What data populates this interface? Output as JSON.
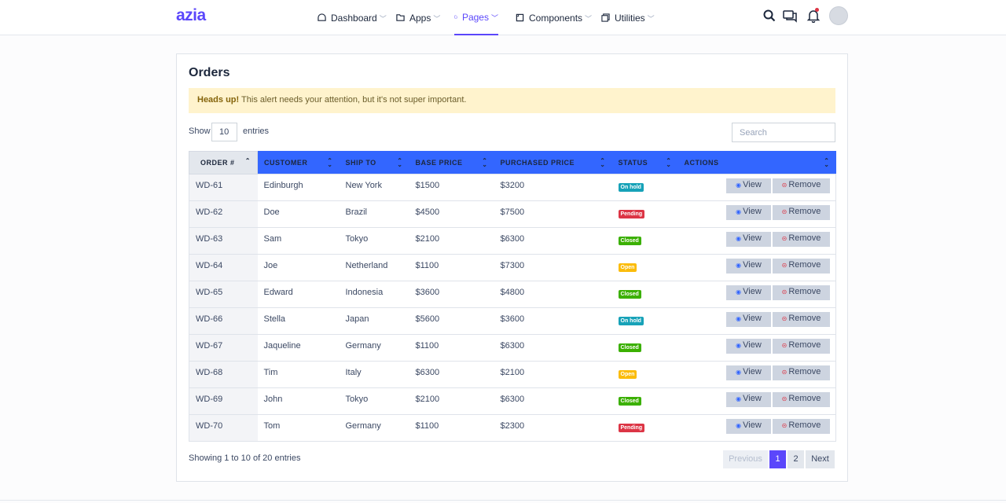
{
  "brand": "azia",
  "nav": [
    {
      "label": "Dashboard",
      "icon": "dashboard-icon"
    },
    {
      "label": "Apps",
      "icon": "folder-icon"
    },
    {
      "label": "Pages",
      "icon": "document-icon"
    },
    {
      "label": "Components",
      "icon": "box-icon"
    },
    {
      "label": "Utilities",
      "icon": "layers-icon"
    }
  ],
  "active_nav": "Pages",
  "colors": {
    "accent": "#5b47fb",
    "table_header": "#3366ff",
    "alert_bg": "#fff3cd"
  },
  "card": {
    "title": "Orders",
    "alert": {
      "strong": "Heads up!",
      "text": "This alert needs your attention, but it's not super important."
    },
    "show_label": "Show",
    "show_value": "10",
    "entries_label": "entries",
    "search_placeholder": "Search"
  },
  "table": {
    "columns": [
      "Order #",
      "Customer",
      "Ship To",
      "Base Price",
      "Purchased Price",
      "Status",
      "Actions"
    ],
    "view_label": "View",
    "remove_label": "Remove",
    "rows": [
      {
        "order": "WD-61",
        "customer": "Edinburgh",
        "ship": "New York",
        "base": "$1500",
        "purchased": "$3200",
        "status": "On hold"
      },
      {
        "order": "WD-62",
        "customer": "Doe",
        "ship": "Brazil",
        "base": "$4500",
        "purchased": "$7500",
        "status": "Pending"
      },
      {
        "order": "WD-63",
        "customer": "Sam",
        "ship": "Tokyo",
        "base": "$2100",
        "purchased": "$6300",
        "status": "Closed"
      },
      {
        "order": "WD-64",
        "customer": "Joe",
        "ship": "Netherland",
        "base": "$1100",
        "purchased": "$7300",
        "status": "Open"
      },
      {
        "order": "WD-65",
        "customer": "Edward",
        "ship": "Indonesia",
        "base": "$3600",
        "purchased": "$4800",
        "status": "Closed"
      },
      {
        "order": "WD-66",
        "customer": "Stella",
        "ship": "Japan",
        "base": "$5600",
        "purchased": "$3600",
        "status": "On hold"
      },
      {
        "order": "WD-67",
        "customer": "Jaqueline",
        "ship": "Germany",
        "base": "$1100",
        "purchased": "$6300",
        "status": "Closed"
      },
      {
        "order": "WD-68",
        "customer": "Tim",
        "ship": "Italy",
        "base": "$6300",
        "purchased": "$2100",
        "status": "Open"
      },
      {
        "order": "WD-69",
        "customer": "John",
        "ship": "Tokyo",
        "base": "$2100",
        "purchased": "$6300",
        "status": "Closed"
      },
      {
        "order": "WD-70",
        "customer": "Tom",
        "ship": "Germany",
        "base": "$1100",
        "purchased": "$2300",
        "status": "Pending"
      }
    ],
    "status_colors": {
      "On hold": "#17a2b8",
      "Pending": "#dc3545",
      "Closed": "#3bb001",
      "Open": "#fbbc0b"
    }
  },
  "footer": {
    "info": "Showing 1 to 10 of 20 entries",
    "pagination": [
      "Previous",
      "1",
      "2",
      "Next"
    ],
    "current_page": "1"
  }
}
